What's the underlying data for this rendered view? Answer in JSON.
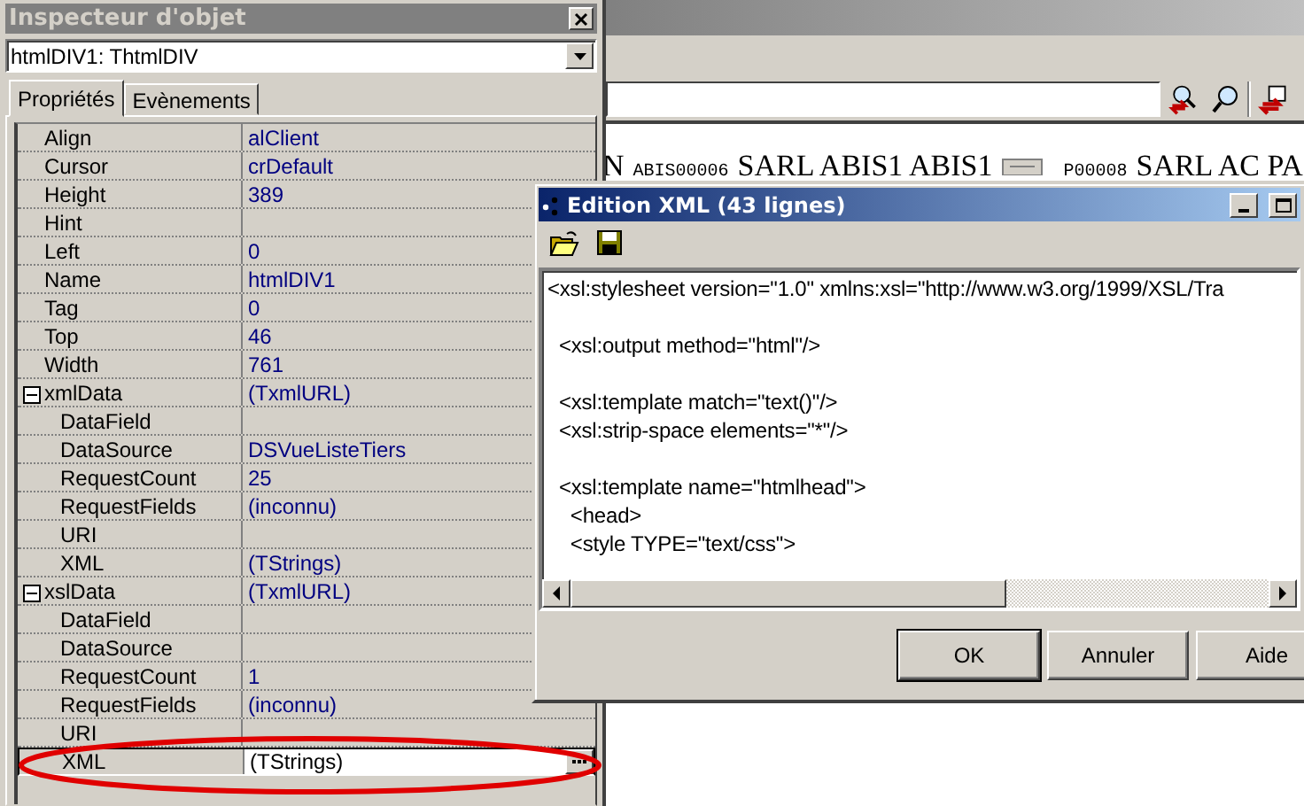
{
  "background": {
    "document_text": [
      {
        "text": "N",
        "kind": "serif"
      },
      {
        "text": "ABIS00006",
        "kind": "code"
      },
      {
        "text": "SARL ABIS1 ABIS1",
        "kind": "serif"
      },
      {
        "text": "P00008",
        "kind": "code"
      },
      {
        "text": "SARL AC PA",
        "kind": "serif"
      }
    ]
  },
  "inspector": {
    "title": "Inspecteur d'objet",
    "object_selector": "htmlDIV1: ThtmlDIV",
    "tabs": [
      {
        "label": "Propriétés",
        "selected": true
      },
      {
        "label": "Evènements",
        "selected": false
      }
    ],
    "properties": [
      {
        "name": "Align",
        "value": "alClient",
        "selected": false
      },
      {
        "name": "Cursor",
        "value": "crDefault",
        "selected": false
      },
      {
        "name": "Height",
        "value": "389",
        "selected": false
      },
      {
        "name": "Hint",
        "selected": false
      },
      {
        "name": "Left",
        "value": "0",
        "selected": false
      },
      {
        "name": "Name",
        "value": "htmlDIV1",
        "selected": false
      },
      {
        "name": "Tag",
        "value": "0",
        "selected": false
      },
      {
        "name": "Top",
        "value": "46",
        "selected": false
      },
      {
        "name": "Width",
        "value": "761",
        "selected": false
      },
      {
        "name": "xmlData",
        "value": "(TxmlURL)",
        "selected": false,
        "expanded": true,
        "children": [
          {
            "name": "DataField",
            "selected": false
          },
          {
            "name": "DataSource",
            "value": "DSVueListeTiers",
            "selected": false
          },
          {
            "name": "RequestCount",
            "value": "25",
            "selected": false
          },
          {
            "name": "RequestFields",
            "value": "(inconnu)",
            "selected": false
          },
          {
            "name": "URI",
            "selected": false
          },
          {
            "name": "XML",
            "value": "(TStrings)",
            "selected": false
          }
        ]
      },
      {
        "name": "xslData",
        "value": "(TxmlURL)",
        "selected": false,
        "expanded": true,
        "children": [
          {
            "name": "DataField",
            "selected": false
          },
          {
            "name": "DataSource",
            "selected": false
          },
          {
            "name": "RequestCount",
            "value": "1",
            "selected": false
          },
          {
            "name": "RequestFields",
            "value": "(inconnu)",
            "selected": false
          },
          {
            "name": "URI",
            "selected": false
          },
          {
            "name": "XML",
            "value": "(TStrings)",
            "selected": true
          }
        ]
      }
    ]
  },
  "xml_editor": {
    "title": "Edition XML (43 lignes)",
    "code": "<xsl:stylesheet version=\"1.0\" xmlns:xsl=\"http://www.w3.org/1999/XSL/Tra\n\n  <xsl:output method=\"html\"/>\n\n  <xsl:template match=\"text()\"/>\n  <xsl:strip-space elements=\"*\"/>\n\n  <xsl:template name=\"htmlhead\">\n    <head>\n    <style TYPE=\"text/css\">",
    "buttons": [
      {
        "label": "OK",
        "default": true
      },
      {
        "label": "Annuler",
        "default": false
      },
      {
        "label": "Aide",
        "default": false
      }
    ]
  },
  "annotation": {
    "kind": "ellipse"
  }
}
